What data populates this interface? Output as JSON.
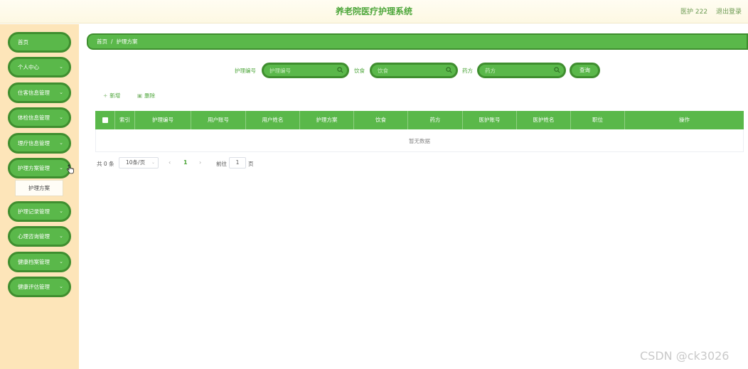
{
  "header": {
    "title": "养老院医疗护理系统",
    "user": "医护 222",
    "logout": "退出登录"
  },
  "sidebar": {
    "items": [
      {
        "label": "首页",
        "expandable": false
      },
      {
        "label": "个人中心",
        "expandable": true
      },
      {
        "label": "住客信息管理",
        "expandable": true
      },
      {
        "label": "体检信息管理",
        "expandable": true
      },
      {
        "label": "理疗信息管理",
        "expandable": true
      },
      {
        "label": "护理方案管理",
        "expandable": true
      },
      {
        "label": "护理记录管理",
        "expandable": true
      },
      {
        "label": "心理咨询管理",
        "expandable": true
      },
      {
        "label": "健康档案管理",
        "expandable": true
      },
      {
        "label": "健康评估管理",
        "expandable": true
      }
    ],
    "submenu": "护理方案"
  },
  "breadcrumb": {
    "home": "首页",
    "separator": "/",
    "current": "护理方案"
  },
  "search": {
    "fields": [
      {
        "label": "护理编号",
        "placeholder": "护理编号"
      },
      {
        "label": "饮食",
        "placeholder": "饮食"
      },
      {
        "label": "药方",
        "placeholder": "药方"
      }
    ],
    "button": "查询"
  },
  "actions": {
    "add": "新增",
    "delete": "删除"
  },
  "table": {
    "columns": [
      "索引",
      "护理编号",
      "用户账号",
      "用户姓名",
      "护理方案",
      "饮食",
      "药方",
      "医护账号",
      "医护姓名",
      "职位",
      "操作"
    ],
    "empty_text": "暂无数据"
  },
  "pagination": {
    "total": "共 0 条",
    "page_size": "10条/页",
    "current_page": "1",
    "goto_prefix": "前往",
    "goto_value": "1",
    "goto_suffix": "页"
  },
  "colors": {
    "primary": "#5ab84a",
    "primary_border": "#3f8e2f",
    "sidebar_bg": "#fde5b9",
    "title": "#4da63a"
  },
  "watermark": "CSDN @ck3026"
}
